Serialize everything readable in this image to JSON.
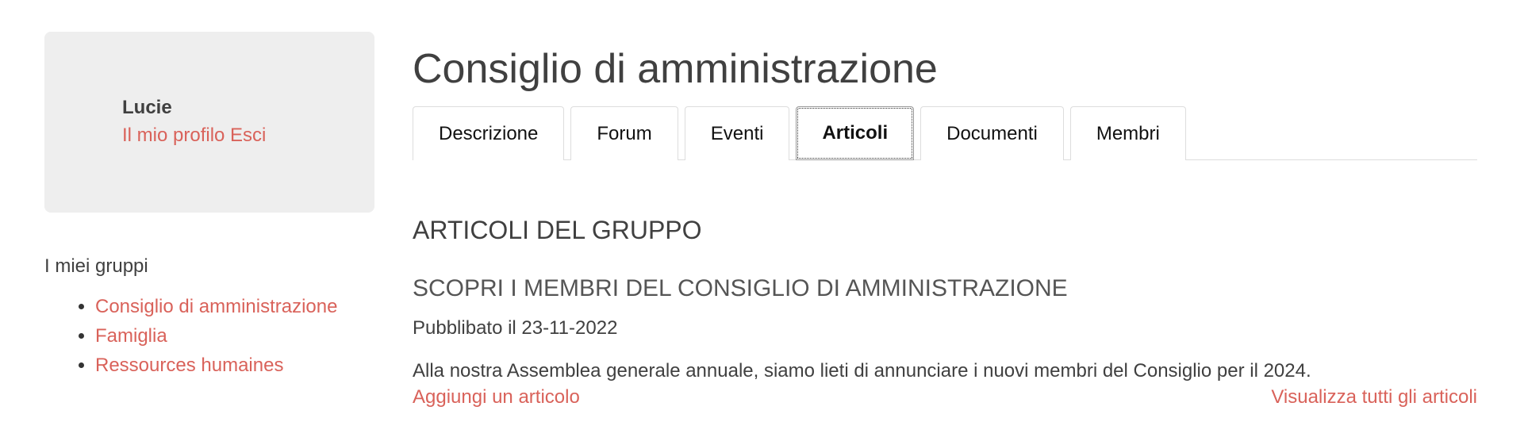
{
  "user": {
    "name": "Lucie",
    "profile_link": "Il mio profilo",
    "logout_link": "Esci"
  },
  "groups": {
    "title": "I miei gruppi",
    "items": [
      {
        "label": "Consiglio di amministrazione"
      },
      {
        "label": "Famiglia"
      },
      {
        "label": "Ressources humaines"
      }
    ]
  },
  "page": {
    "title": "Consiglio di amministrazione"
  },
  "tabs": [
    {
      "label": "Descrizione",
      "active": false
    },
    {
      "label": "Forum",
      "active": false
    },
    {
      "label": "Eventi",
      "active": false
    },
    {
      "label": "Articoli",
      "active": true
    },
    {
      "label": "Documenti",
      "active": false
    },
    {
      "label": "Membri",
      "active": false
    }
  ],
  "articles": {
    "section_title": "ARTICOLI DEL GRUPPO",
    "items": [
      {
        "title": "SCOPRI I MEMBRI DEL CONSIGLIO DI AMMINISTRAZIONE",
        "date": "Pubblibato il 23-11-2022",
        "excerpt": "Alla nostra Assemblea generale annuale, siamo lieti di annunciare i nuovi membri del Consiglio per il 2024."
      }
    ],
    "add_link": "Aggiungi un articolo",
    "view_all_link": "Visualizza tutti gli articoli"
  },
  "colors": {
    "accent": "#d9625a",
    "card_bg": "#eeeeee",
    "text": "#404040"
  }
}
